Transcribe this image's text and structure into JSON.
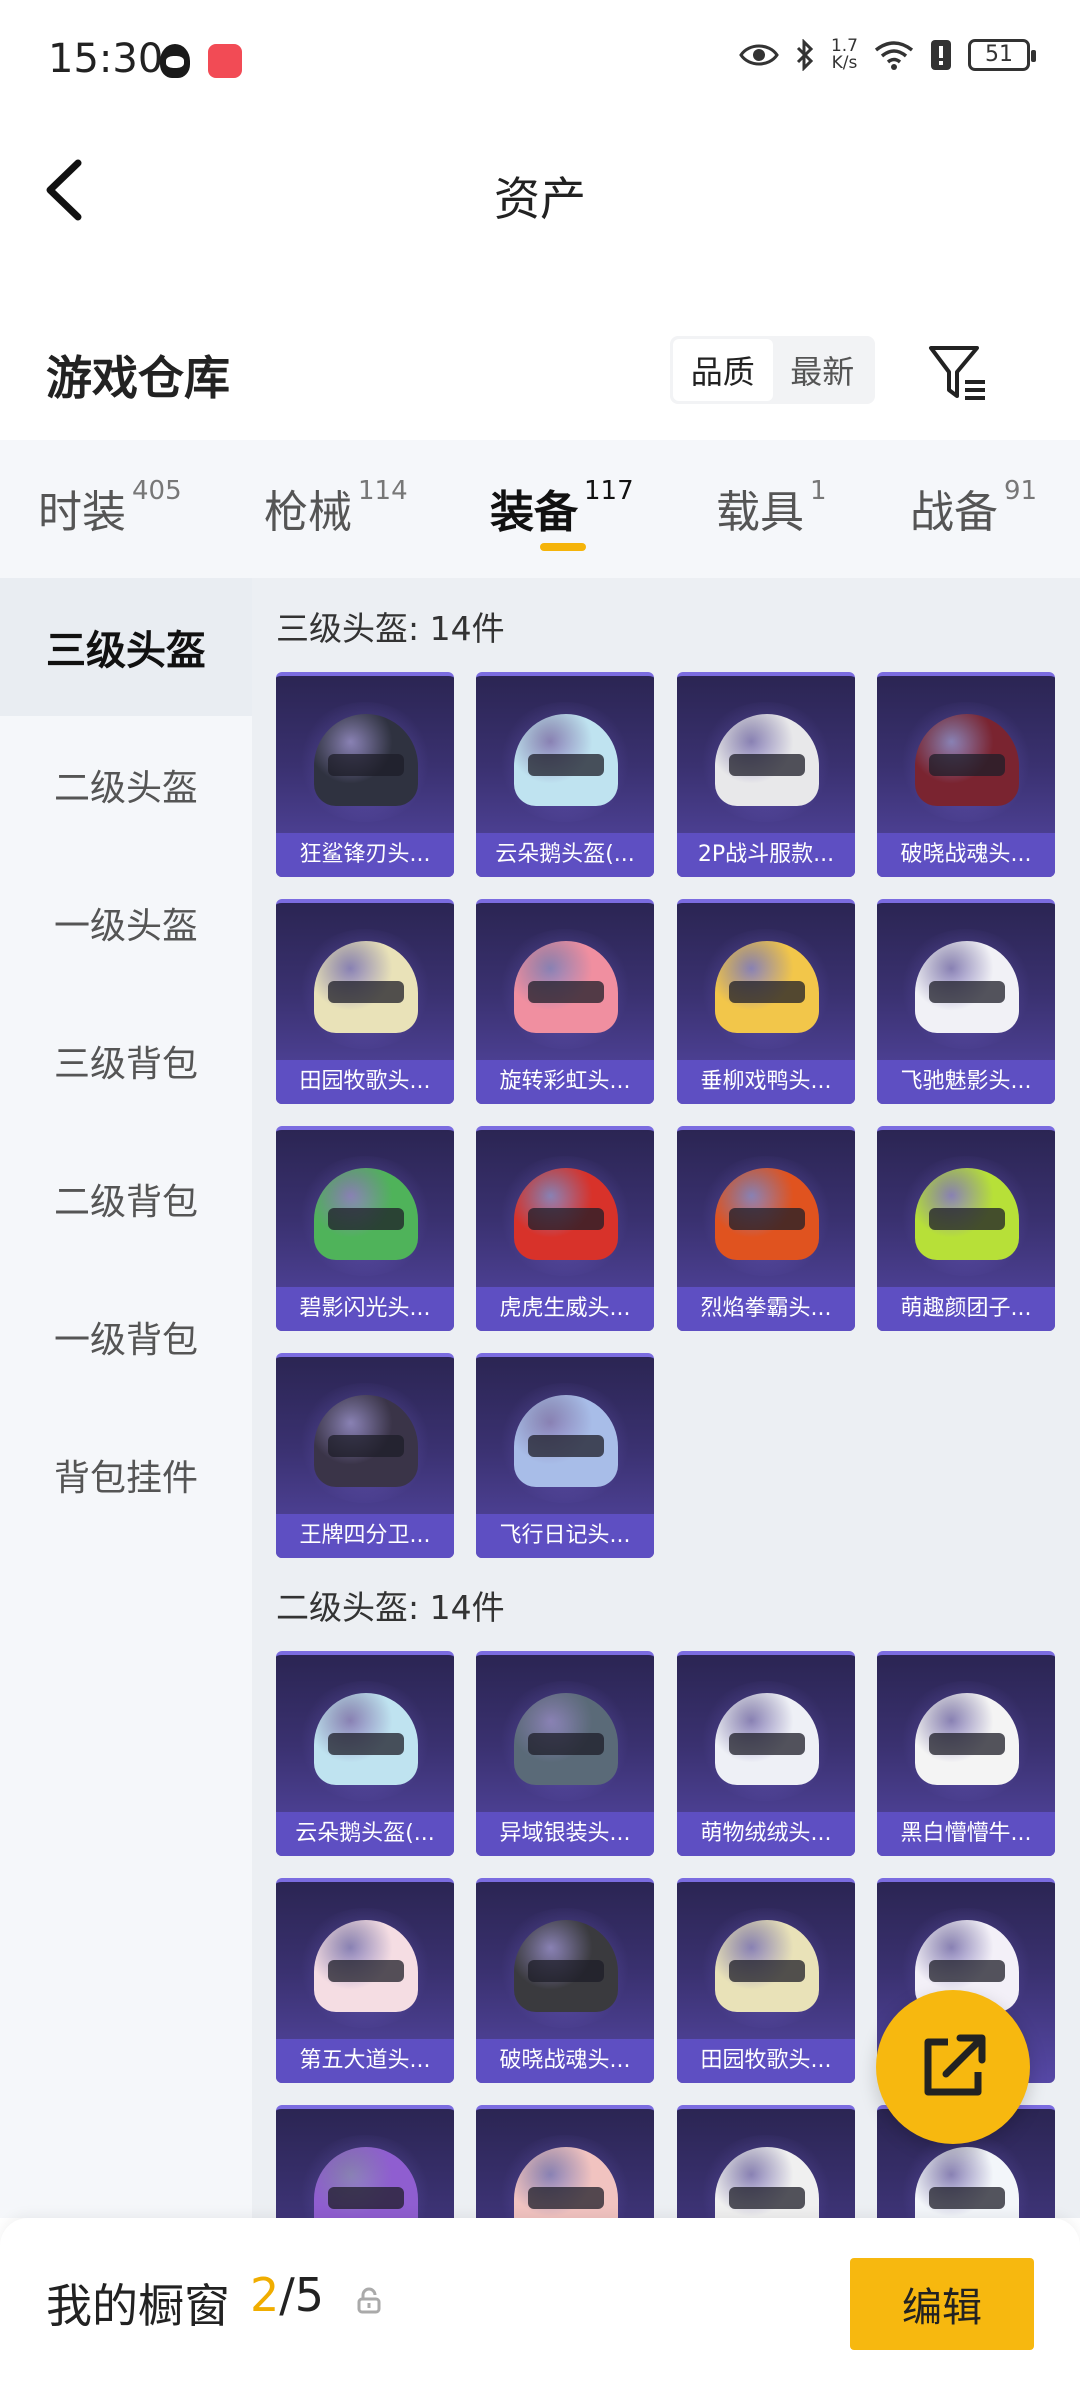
{
  "status_bar": {
    "time": "15:30",
    "network_speed_top": "1.7",
    "network_speed_unit": "K/s",
    "battery": "51"
  },
  "header": {
    "title": "资产"
  },
  "warehouse": {
    "title": "游戏仓库",
    "sort_options": [
      "品质",
      "最新"
    ],
    "active_sort": "品质"
  },
  "category_tabs": [
    {
      "label": "时装",
      "count": "405"
    },
    {
      "label": "枪械",
      "count": "114"
    },
    {
      "label": "装备",
      "count": "117"
    },
    {
      "label": "载具",
      "count": "1"
    },
    {
      "label": "战备",
      "count": "91"
    }
  ],
  "active_category": "装备",
  "left_nav": [
    "三级头盔",
    "二级头盔",
    "一级头盔",
    "三级背包",
    "二级背包",
    "一级背包",
    "背包挂件"
  ],
  "active_nav": "三级头盔",
  "sections": [
    {
      "title": "三级头盔: 14件",
      "items": [
        {
          "name": "狂鲨锋刃头...",
          "color": "#2f3240"
        },
        {
          "name": "云朵鹅头盔(...",
          "color": "#bfe3f0"
        },
        {
          "name": "2P战斗服款...",
          "color": "#e8e8ea"
        },
        {
          "name": "破晓战魂头...",
          "color": "#7a2430"
        },
        {
          "name": "田园牧歌头...",
          "color": "#e9e2b8"
        },
        {
          "name": "旋转彩虹头...",
          "color": "#f08fa0"
        },
        {
          "name": "垂柳戏鸭头...",
          "color": "#f2c64a"
        },
        {
          "name": "飞驰魅影头...",
          "color": "#f1f1f6"
        },
        {
          "name": "碧影闪光头...",
          "color": "#4fb35a"
        },
        {
          "name": "虎虎生威头...",
          "color": "#d8322a"
        },
        {
          "name": "烈焰拳霸头...",
          "color": "#e0531f"
        },
        {
          "name": "萌趣颜团子...",
          "color": "#b7e038"
        },
        {
          "name": "王牌四分卫...",
          "color": "#3a3448"
        },
        {
          "name": "飞行日记头...",
          "color": "#a8bde8"
        }
      ]
    },
    {
      "title": "二级头盔: 14件",
      "items": [
        {
          "name": "云朵鹅头盔(...",
          "color": "#bfe3f0"
        },
        {
          "name": "异域银装头...",
          "color": "#5a6a78"
        },
        {
          "name": "萌物绒绒头...",
          "color": "#eef0f6"
        },
        {
          "name": "黑白懵懵牛...",
          "color": "#f4f4f4"
        },
        {
          "name": "第五大道头...",
          "color": "#f5dde3"
        },
        {
          "name": "破晓战魂头...",
          "color": "#3a3a3e"
        },
        {
          "name": "田园牧歌头...",
          "color": "#e9e2b8"
        },
        {
          "name": "",
          "color": "#f3f0f8"
        },
        {
          "name": "",
          "color": "#8f5ed0"
        },
        {
          "name": "",
          "color": "#f1c3c0"
        },
        {
          "name": "",
          "color": "#f0f0f0"
        },
        {
          "name": "",
          "color": "#f3f6fa"
        }
      ]
    }
  ],
  "bottom_bar": {
    "title": "我的橱窗",
    "current": "2",
    "total": "/5",
    "edit_label": "编辑"
  }
}
